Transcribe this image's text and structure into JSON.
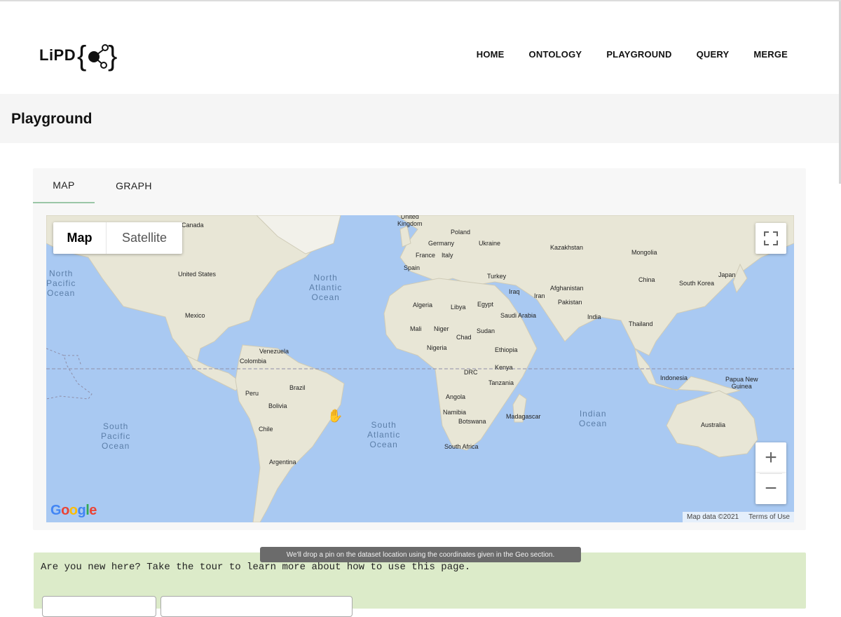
{
  "header": {
    "logo_text": "LiPD",
    "nav": [
      "HOME",
      "ONTOLOGY",
      "PLAYGROUND",
      "QUERY",
      "MERGE"
    ]
  },
  "page": {
    "title": "Playground"
  },
  "tabs": [
    "MAP",
    "GRAPH"
  ],
  "map": {
    "type_control": {
      "map": "Map",
      "satellite": "Satellite"
    },
    "zoom_in": "+",
    "zoom_out": "−",
    "google_logo": "Google",
    "attribution": {
      "data": "Map data ©2021",
      "terms": "Terms of Use"
    },
    "oceans": {
      "north_pacific": "North\nPacific\nOcean",
      "north_atlantic": "North\nAtlantic\nOcean",
      "south_pacific": "South\nPacific\nOcean",
      "south_atlantic": "South\nAtlantic\nOcean",
      "indian": "Indian\nOcean"
    },
    "countries": {
      "canada": "Canada",
      "united_states": "United States",
      "mexico": "Mexico",
      "venezuela": "Venezuela",
      "colombia": "Colombia",
      "peru": "Peru",
      "brazil": "Brazil",
      "bolivia": "Bolivia",
      "chile": "Chile",
      "argentina": "Argentina",
      "united_kingdom": "United\nKingdom",
      "poland": "Poland",
      "germany": "Germany",
      "ukraine": "Ukraine",
      "france": "France",
      "italy": "Italy",
      "spain": "Spain",
      "turkey": "Turkey",
      "kazakhstan": "Kazakhstan",
      "mongolia": "Mongolia",
      "china": "China",
      "japan": "Japan",
      "south_korea": "South Korea",
      "afghanistan": "Afghanistan",
      "iraq": "Iraq",
      "iran": "Iran",
      "pakistan": "Pakistan",
      "india": "India",
      "thailand": "Thailand",
      "algeria": "Algeria",
      "libya": "Libya",
      "egypt": "Egypt",
      "saudi_arabia": "Saudi Arabia",
      "mali": "Mali",
      "niger": "Niger",
      "chad": "Chad",
      "sudan": "Sudan",
      "nigeria": "Nigeria",
      "ethiopia": "Ethiopia",
      "kenya": "Kenya",
      "drc": "DRC",
      "tanzania": "Tanzania",
      "angola": "Angola",
      "namibia": "Namibia",
      "botswana": "Botswana",
      "madagascar": "Madagascar",
      "south_africa": "South Africa",
      "indonesia": "Indonesia",
      "papua_new_guinea": "Papua New\nGuinea",
      "australia": "Australia"
    }
  },
  "tooltip": "We'll drop a pin on the dataset location using the coordinates given in the Geo section.",
  "tour": {
    "text": "Are you new here? Take the tour to learn more about how to use this page."
  },
  "colors": {
    "tab_underline": "#9ac6a6",
    "tour_bg": "#dcebc9",
    "water": "#a9c9f2",
    "land": "#e8e6d6"
  }
}
